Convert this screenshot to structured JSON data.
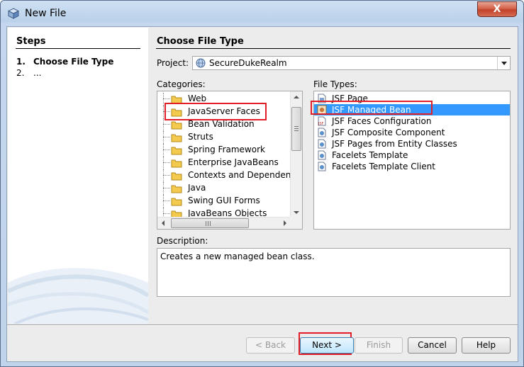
{
  "window": {
    "title": "New File",
    "close_label": "X"
  },
  "steps": {
    "title": "Steps",
    "items": [
      {
        "num": "1.",
        "label": "Choose File Type"
      },
      {
        "num": "2.",
        "label": "..."
      }
    ]
  },
  "main": {
    "section_title": "Choose File Type",
    "project_label": "Project:",
    "project_value": "SecureDukeRealm",
    "categories_label": "Categories:",
    "categories": [
      "Web",
      "JavaServer Faces",
      "Bean Validation",
      "Struts",
      "Spring Framework",
      "Enterprise JavaBeans",
      "Contexts and Dependency Injection",
      "Java",
      "Swing GUI Forms",
      "JavaBeans Objects"
    ],
    "file_types_label": "File Types:",
    "file_types": [
      "JSF Page",
      "JSF Managed Bean",
      "JSF Faces Configuration",
      "JSF Composite Component",
      "JSF Pages from Entity Classes",
      "Facelets Template",
      "Facelets Template Client"
    ],
    "selected_category": "JavaServer Faces",
    "selected_file_type": "JSF Managed Bean",
    "description_label": "Description:",
    "description": "Creates a new managed bean class."
  },
  "buttons": {
    "back": "< Back",
    "next": "Next >",
    "finish": "Finish",
    "cancel": "Cancel",
    "help": "Help"
  },
  "colors": {
    "selection": "#3399ff",
    "highlight_box": "#e21f26",
    "title_bar": "#c4d7ee"
  }
}
